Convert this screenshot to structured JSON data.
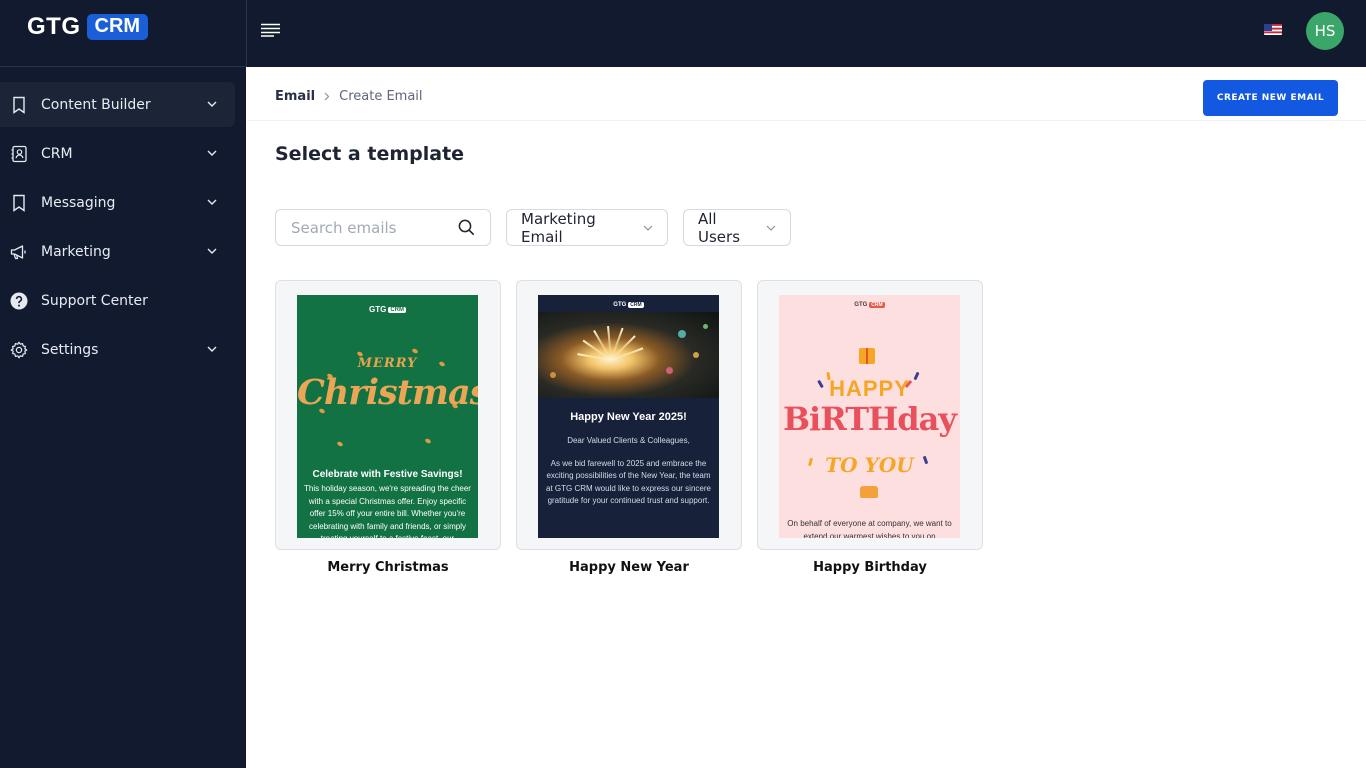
{
  "app": {
    "logo_text": "GTG",
    "logo_badge": "CRM"
  },
  "sidebar": {
    "items": [
      {
        "label": "Content Builder",
        "icon": "bookmark-icon",
        "has_chevron": true,
        "active": true
      },
      {
        "label": "CRM",
        "icon": "contacts-icon",
        "has_chevron": true
      },
      {
        "label": "Messaging",
        "icon": "bookmark-icon",
        "has_chevron": true
      },
      {
        "label": "Marketing",
        "icon": "megaphone-icon",
        "has_chevron": true
      },
      {
        "label": "Support Center",
        "icon": "help-icon",
        "has_chevron": false
      },
      {
        "label": "Settings",
        "icon": "gear-icon",
        "has_chevron": true
      }
    ]
  },
  "topbar": {
    "menu_icon": "menu-icon",
    "flag_icon": "us-flag-icon",
    "avatar_initials": "HS",
    "avatar_color": "#3aa66a"
  },
  "breadcrumb": {
    "root": "Email",
    "separator": ">",
    "current": "Create Email"
  },
  "actions": {
    "create_label": "CREATE NEW EMAIL"
  },
  "page": {
    "title": "Select a template"
  },
  "filters": {
    "search_placeholder": "Search emails",
    "type_value": "Marketing Email",
    "users_value": "All Users"
  },
  "templates": [
    {
      "name": "Merry Christmas",
      "logo_text": "GTG",
      "logo_badge": "CRM",
      "art_small": "MERRY",
      "art_main": "Christmas",
      "heading": "Celebrate with Festive Savings!",
      "body": "This holiday season, we're spreading the cheer with a special Christmas offer. Enjoy specific offer 15% off your entire bill. Whether you're celebrating with family and friends, or simply treating yourself to a festive feast, our"
    },
    {
      "name": "Happy New Year",
      "logo_text": "GTG",
      "logo_badge": "CRM",
      "heading": "Happy New Year 2025!",
      "greeting": "Dear Valued Clients & Colleagues,",
      "body": "As we bid farewell to 2025 and embrace the exciting possibilities of the New Year, the team at GTG CRM would like to express our sincere gratitude for your continued trust and support."
    },
    {
      "name": "Happy Birthday",
      "logo_text": "GTG",
      "logo_badge": "CRM",
      "art_small": "HAPPY",
      "art_main": "BiRTHday",
      "art_to": "TO YOU",
      "body": "On behalf of everyone at company, we want to extend our warmest wishes to you on"
    }
  ],
  "colors": {
    "sidebar_bg": "#111a2e",
    "accent": "#1358e0",
    "xmas_bg": "#137244",
    "ny_bg": "#17213a",
    "bday_bg": "#fddfe0"
  }
}
